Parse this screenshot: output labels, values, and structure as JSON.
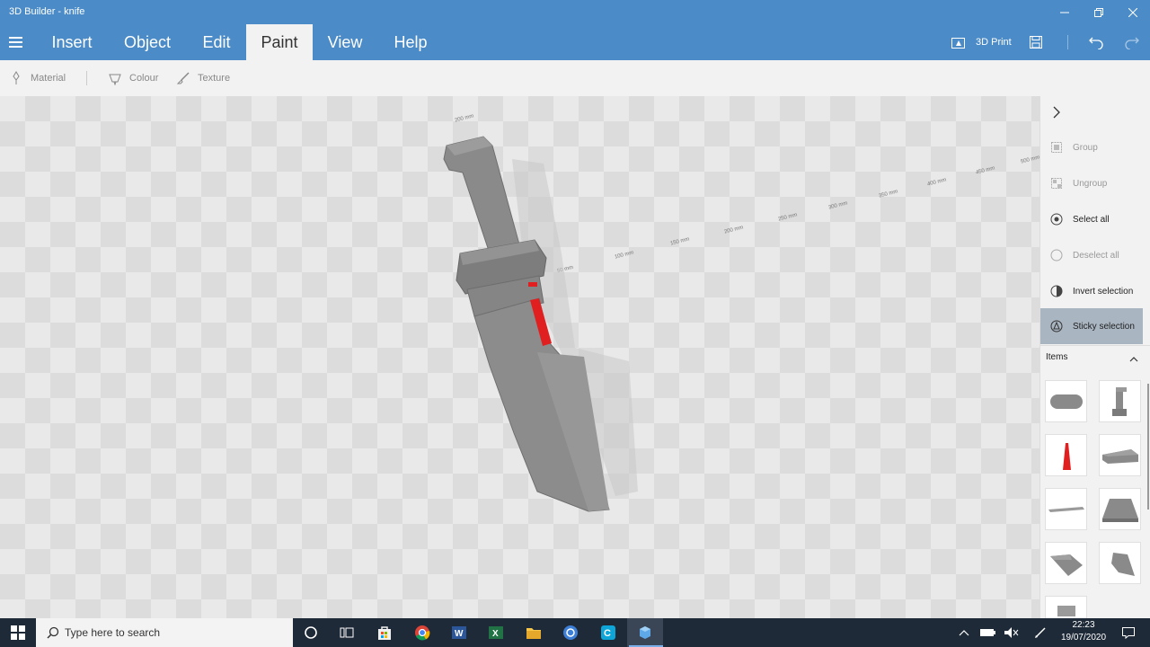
{
  "window": {
    "title": "3D Builder - knife"
  },
  "menu": {
    "tabs": [
      {
        "label": "Insert"
      },
      {
        "label": "Object"
      },
      {
        "label": "Edit"
      },
      {
        "label": "Paint"
      },
      {
        "label": "View"
      },
      {
        "label": "Help"
      }
    ],
    "active_tab": "Paint",
    "print_label": "3D Print"
  },
  "toolbar": {
    "material_label": "Material",
    "colour_label": "Colour",
    "texture_label": "Texture"
  },
  "viewport": {
    "ruler_labels": [
      "200 mm",
      "50 mm",
      "100 mm",
      "150 mm",
      "200 mm",
      "250 mm",
      "300 mm",
      "350 mm",
      "400 mm",
      "450 mm",
      "500 mm"
    ]
  },
  "panel": {
    "actions": [
      {
        "label": "Group",
        "state": "disabled"
      },
      {
        "label": "Ungroup",
        "state": "disabled"
      },
      {
        "label": "Select all",
        "state": "enabled"
      },
      {
        "label": "Deselect all",
        "state": "disabled"
      },
      {
        "label": "Invert selection",
        "state": "enabled"
      },
      {
        "label": "Sticky selection",
        "state": "active"
      }
    ],
    "items_label": "Items",
    "accent_red": "#e02020"
  },
  "taskbar": {
    "search_placeholder": "Type here to search",
    "time": "22:23",
    "date": "19/07/2020"
  },
  "colors": {
    "ribbon": "#4b8bc7",
    "highlight": "#e02020",
    "model_grey": "#8a8a8a"
  }
}
